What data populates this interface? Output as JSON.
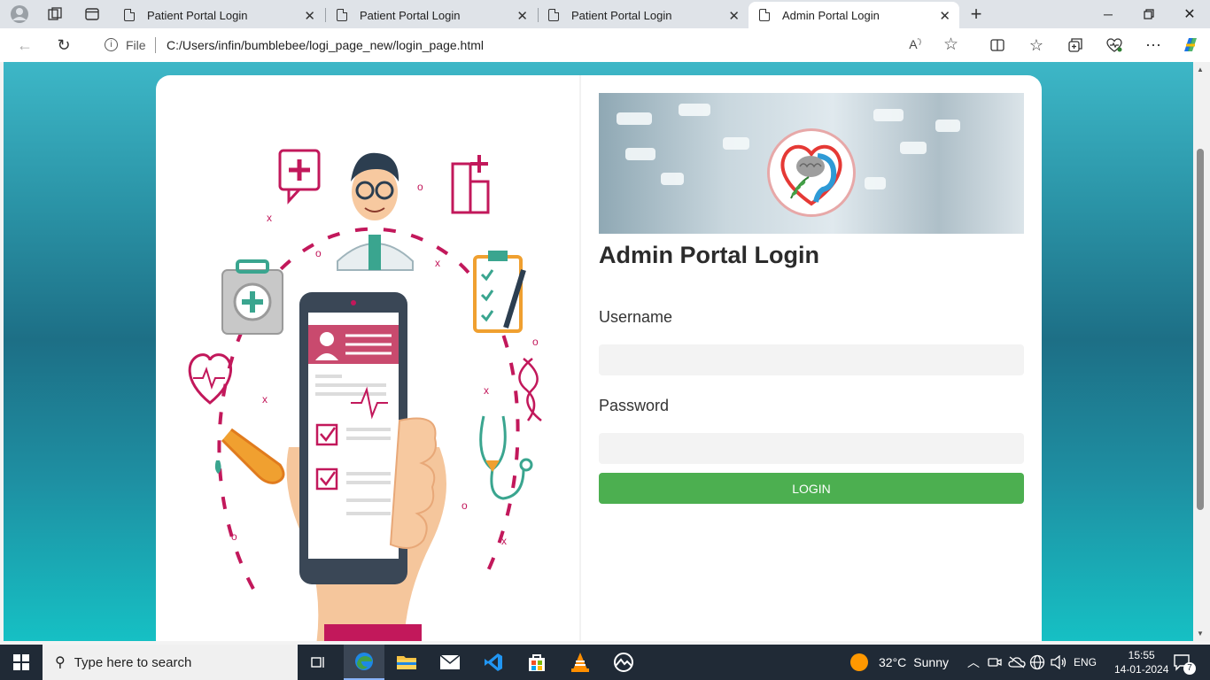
{
  "browser": {
    "tabs": [
      {
        "title": "Patient Portal Login"
      },
      {
        "title": "Patient Portal Login"
      },
      {
        "title": "Patient Portal Login"
      },
      {
        "title": "Admin Portal Login"
      }
    ],
    "address": {
      "scheme_label": "File",
      "url": "C:/Users/infin/bumblebee/logi_page_new/login_page.html"
    }
  },
  "login": {
    "title": "Admin Portal Login",
    "username_label": "Username",
    "username_value": "",
    "password_label": "Password",
    "password_value": "",
    "button_label": "LOGIN"
  },
  "colors": {
    "accent_button": "#4caf50",
    "page_gradient_top": "#3db7c7",
    "illustration_pink": "#c2185b"
  },
  "taskbar": {
    "search_placeholder": "Type here to search",
    "weather_temp": "32°C",
    "weather_desc": "Sunny",
    "language": "ENG",
    "time": "15:55",
    "date": "14-01-2024",
    "notification_count": "7"
  }
}
